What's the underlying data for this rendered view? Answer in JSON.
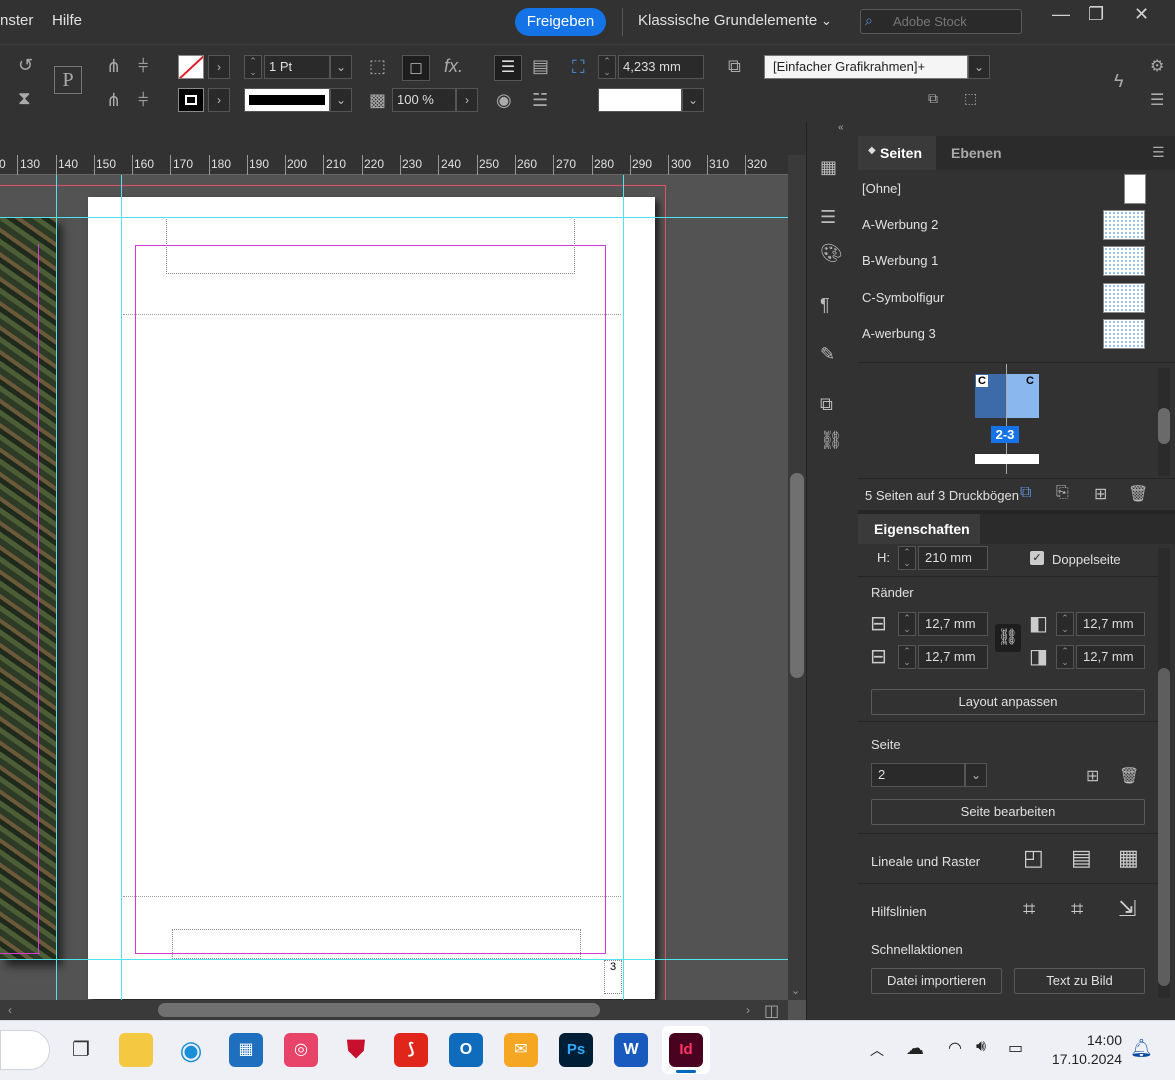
{
  "menubar": {
    "items": [
      "nster",
      "Hilfe"
    ],
    "share_label": "Freigeben",
    "workspace": "Klassische Grundelemente",
    "stock_placeholder": "Adobe Stock"
  },
  "control": {
    "stroke_weight": "1 Pt",
    "opacity": "100 %",
    "offset": "4,233 mm",
    "object_style": "[Einfacher Grafikrahmen]+"
  },
  "ruler": {
    "ticks": [
      "0",
      "130",
      "140",
      "150",
      "160",
      "170",
      "180",
      "190",
      "200",
      "210",
      "220",
      "230",
      "240",
      "250",
      "260",
      "270",
      "280",
      "290",
      "300",
      "310",
      "320"
    ]
  },
  "document": {
    "page_number": "3"
  },
  "pages_panel": {
    "tab_pages": "Seiten",
    "tab_layers": "Ebenen",
    "masters": [
      "[Ohne]",
      "A-Werbung 2",
      "B-Werbung 1",
      "C-Symbolfigur",
      "A-werbung 3"
    ],
    "spread_label": "2-3",
    "spread_prefix_left": "C",
    "spread_prefix_right": "C",
    "summary": "5 Seiten auf 3 Druckbögen"
  },
  "properties": {
    "tab": "Eigenschaften",
    "height_label": "H:",
    "height_value": "210 mm",
    "facing_pages": "Doppelseite",
    "margins_title": "Ränder",
    "margin_top": "12,7 mm",
    "margin_bottom": "12,7 mm",
    "margin_left": "12,7 mm",
    "margin_right": "12,7 mm",
    "adjust_layout": "Layout anpassen",
    "page_title": "Seite",
    "page_value": "2",
    "edit_page": "Seite bearbeiten",
    "rulers_grids": "Lineale und Raster",
    "guides": "Hilfslinien",
    "quick_actions": "Schnellaktionen",
    "import_file": "Datei importieren",
    "text_to_image": "Text zu Bild"
  },
  "taskbar": {
    "time": "14:00",
    "date": "17.10.2024"
  }
}
